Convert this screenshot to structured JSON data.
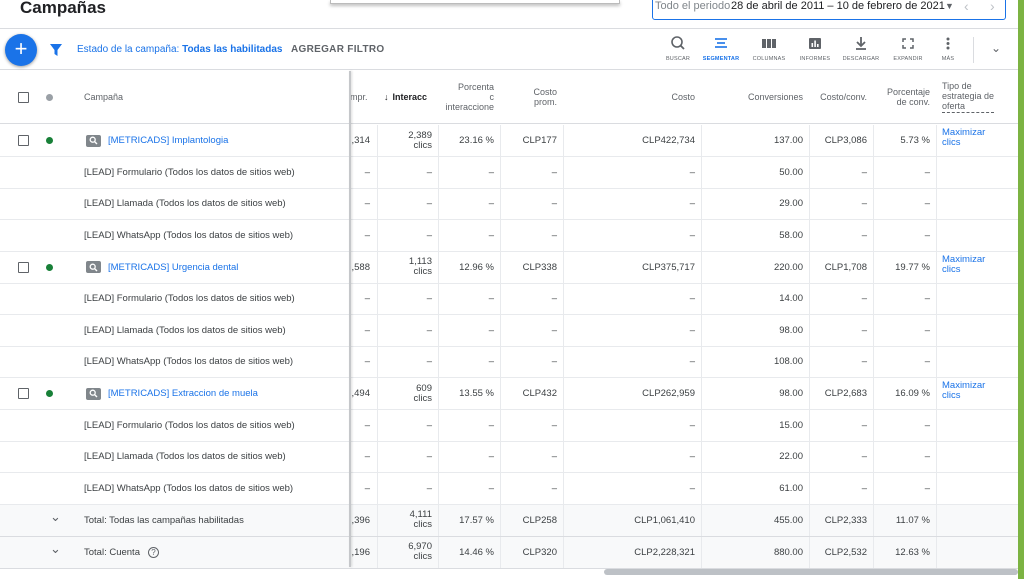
{
  "header": {
    "title": "Campañas",
    "date_label": "Todo el periodo",
    "date_range": "28 de abril de 2011 – 10 de febrero de 2021"
  },
  "toolbar": {
    "filter_prefix": "Estado de la campaña: ",
    "filter_value": "Todas las habilitadas",
    "add_filter": "AGREGAR FILTRO",
    "tools": [
      {
        "label": "BUSCAR",
        "icon": "search-icon"
      },
      {
        "label": "SEGMENTAR",
        "icon": "segment-icon"
      },
      {
        "label": "COLUMNAS",
        "icon": "columns-icon"
      },
      {
        "label": "INFORMES",
        "icon": "reports-icon"
      },
      {
        "label": "DESCARGAR",
        "icon": "download-icon"
      },
      {
        "label": "EXPANDIR",
        "icon": "expand-icon"
      },
      {
        "label": "MÁS",
        "icon": "more-vert-icon"
      }
    ]
  },
  "colors": {
    "accent": "#1a73e8",
    "status_enabled": "#188038",
    "edge": "#7cb342"
  },
  "columns": {
    "campaign": "Campaña",
    "impr": "mpr.",
    "interactions": "Interacc",
    "interaction_rate_1": "Porcenta",
    "interaction_rate_2": "c",
    "interaction_rate_3": "interaccione",
    "avg_cost_1": "Costo",
    "avg_cost_2": "prom.",
    "cost": "Costo",
    "conversions": "Conversiones",
    "cost_conv": "Costo/conv.",
    "conv_rate_1": "Porcentaje",
    "conv_rate_2": "de conv.",
    "bid_1": "Tipo de",
    "bid_2": "estrategia de",
    "bid_3": "oferta"
  },
  "rows": [
    {
      "type": "camp",
      "name": "[METRICADS] Implantologia",
      "impr": ",314",
      "inter_1": "2,389",
      "inter_2": "clics",
      "rate": "23.16 %",
      "avg": "CLP177",
      "cost": "CLP422,734",
      "conv": "137.00",
      "cpconv": "CLP3,086",
      "crate": "5.73 %",
      "bid_1": "Maximizar",
      "bid_2": "clics"
    },
    {
      "type": "sub",
      "name": "[LEAD] Formulario (Todos los datos de sitios web)",
      "impr": "–",
      "inter": "–",
      "rate": "–",
      "avg": "–",
      "cost": "–",
      "conv": "50.00",
      "cpconv": "–",
      "crate": "–"
    },
    {
      "type": "sub",
      "name": "[LEAD] Llamada (Todos los datos de sitios web)",
      "impr": "–",
      "inter": "–",
      "rate": "–",
      "avg": "–",
      "cost": "–",
      "conv": "29.00",
      "cpconv": "–",
      "crate": "–"
    },
    {
      "type": "sub",
      "name": "[LEAD] WhatsApp (Todos los datos de sitios web)",
      "impr": "–",
      "inter": "–",
      "rate": "–",
      "avg": "–",
      "cost": "–",
      "conv": "58.00",
      "cpconv": "–",
      "crate": "–"
    },
    {
      "type": "camp",
      "name": "[METRICADS] Urgencia dental",
      "impr": ",588",
      "inter_1": "1,113",
      "inter_2": "clics",
      "rate": "12.96 %",
      "avg": "CLP338",
      "cost": "CLP375,717",
      "conv": "220.00",
      "cpconv": "CLP1,708",
      "crate": "19.77 %",
      "bid_1": "Maximizar",
      "bid_2": "clics"
    },
    {
      "type": "sub",
      "name": "[LEAD] Formulario (Todos los datos de sitios web)",
      "impr": "–",
      "inter": "–",
      "rate": "–",
      "avg": "–",
      "cost": "–",
      "conv": "14.00",
      "cpconv": "–",
      "crate": "–"
    },
    {
      "type": "sub",
      "name": "[LEAD] Llamada (Todos los datos de sitios web)",
      "impr": "–",
      "inter": "–",
      "rate": "–",
      "avg": "–",
      "cost": "–",
      "conv": "98.00",
      "cpconv": "–",
      "crate": "–"
    },
    {
      "type": "sub",
      "name": "[LEAD] WhatsApp (Todos los datos de sitios web)",
      "impr": "–",
      "inter": "–",
      "rate": "–",
      "avg": "–",
      "cost": "–",
      "conv": "108.00",
      "cpconv": "–",
      "crate": "–"
    },
    {
      "type": "camp",
      "name": "[METRICADS] Extraccion de muela",
      "impr": ",494",
      "inter_1": "609",
      "inter_2": "clics",
      "rate": "13.55 %",
      "avg": "CLP432",
      "cost": "CLP262,959",
      "conv": "98.00",
      "cpconv": "CLP2,683",
      "crate": "16.09 %",
      "bid_1": "Maximizar",
      "bid_2": "clics"
    },
    {
      "type": "sub",
      "name": "[LEAD] Formulario (Todos los datos de sitios web)",
      "impr": "–",
      "inter": "–",
      "rate": "–",
      "avg": "–",
      "cost": "–",
      "conv": "15.00",
      "cpconv": "–",
      "crate": "–"
    },
    {
      "type": "sub",
      "name": "[LEAD] Llamada (Todos los datos de sitios web)",
      "impr": "–",
      "inter": "–",
      "rate": "–",
      "avg": "–",
      "cost": "–",
      "conv": "22.00",
      "cpconv": "–",
      "crate": "–"
    },
    {
      "type": "sub",
      "name": "[LEAD] WhatsApp (Todos los datos de sitios web)",
      "impr": "–",
      "inter": "–",
      "rate": "–",
      "avg": "–",
      "cost": "–",
      "conv": "61.00",
      "cpconv": "–",
      "crate": "–"
    }
  ],
  "totals": [
    {
      "name": "Total: Todas las campañas habilitadas",
      "impr": ",396",
      "inter_1": "4,111",
      "inter_2": "clics",
      "rate": "17.57 %",
      "avg": "CLP258",
      "cost": "CLP1,061,410",
      "conv": "455.00",
      "cpconv": "CLP2,333",
      "crate": "11.07 %",
      "help": false
    },
    {
      "name": "Total: Cuenta",
      "impr": ",196",
      "inter_1": "6,970",
      "inter_2": "clics",
      "rate": "14.46 %",
      "avg": "CLP320",
      "cost": "CLP2,228,321",
      "conv": "880.00",
      "cpconv": "CLP2,532",
      "crate": "12.63 %",
      "help": true
    }
  ]
}
